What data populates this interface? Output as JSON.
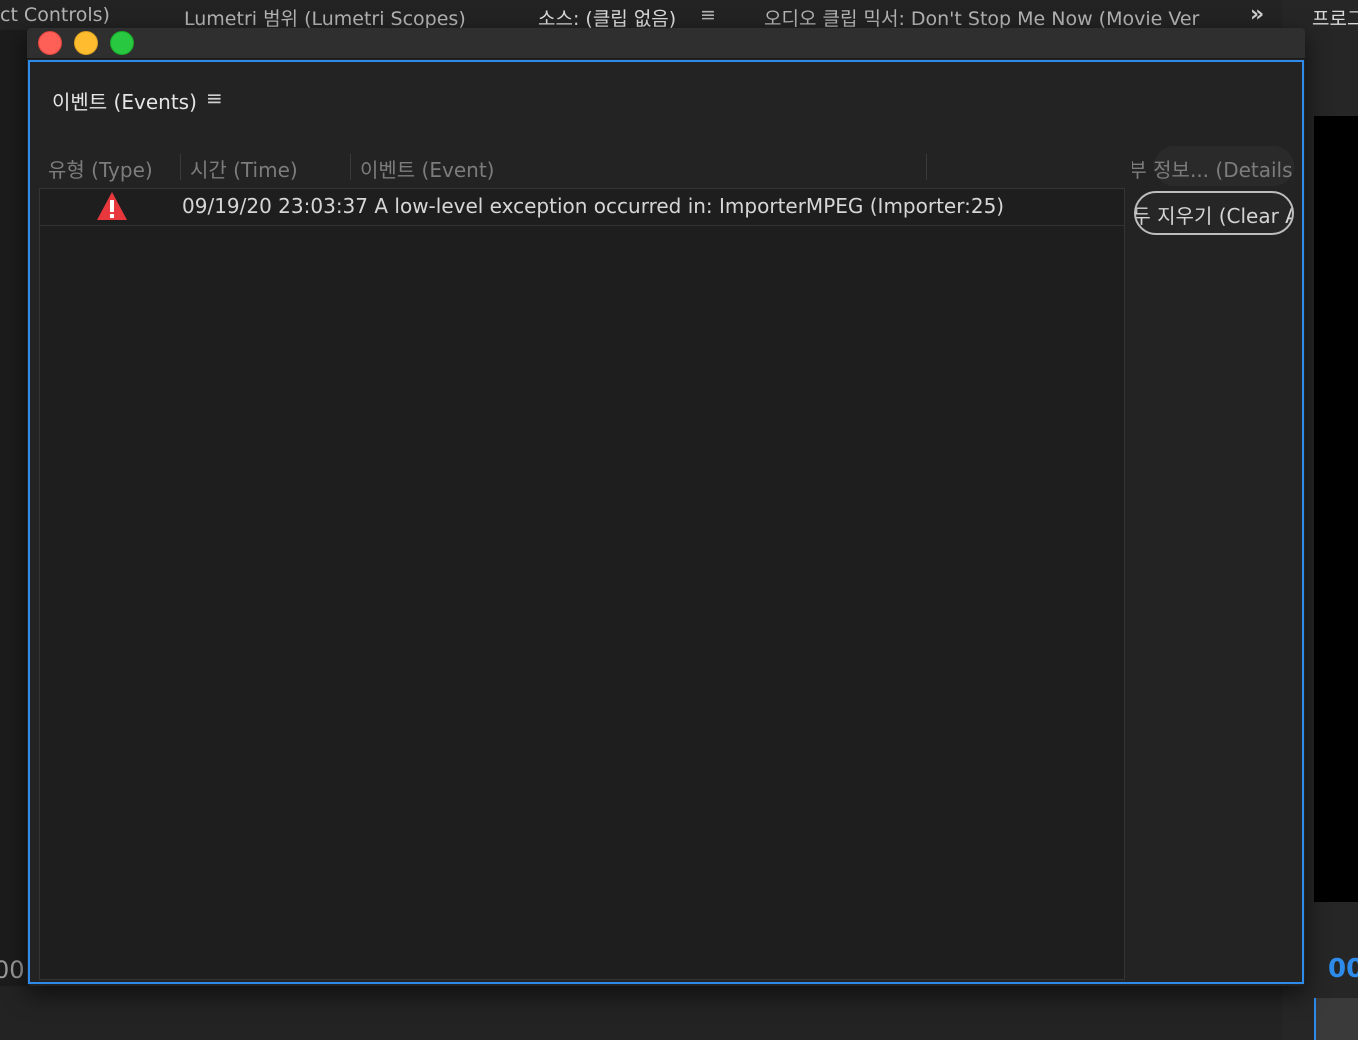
{
  "background": {
    "tabs": [
      {
        "label": "ct Controls)"
      },
      {
        "label": "Lumetri 범위 (Lumetri Scopes)"
      },
      {
        "label": "소스: (클립 없음)"
      },
      {
        "label": "오디오 클립 믹서: Don't Stop Me Now (Movie Ver"
      }
    ],
    "menu_icon": "≡",
    "overflow_icon": "»",
    "right_panel_title": "프로그",
    "right_timecode": "00",
    "left_timecode": "00"
  },
  "window": {
    "panel": {
      "title": "이벤트 (Events)",
      "menu_icon": "≡",
      "columns": {
        "type": "유형 (Type)",
        "time": "시간 (Time)",
        "event": "이벤트 (Event)"
      },
      "events": [
        {
          "type_icon": "warning-triangle-icon",
          "text": "09/19/20 23:03:37 A low-level exception occurred in: ImporterMPEG (Importer:25)"
        }
      ],
      "details_label": "세부 정보... (Details...)",
      "clear_all_label": "모두 지우기 (Clear All)"
    }
  },
  "colors": {
    "accent": "#2d8ceb",
    "error": "#e8383d",
    "panel_bg": "#232323"
  }
}
